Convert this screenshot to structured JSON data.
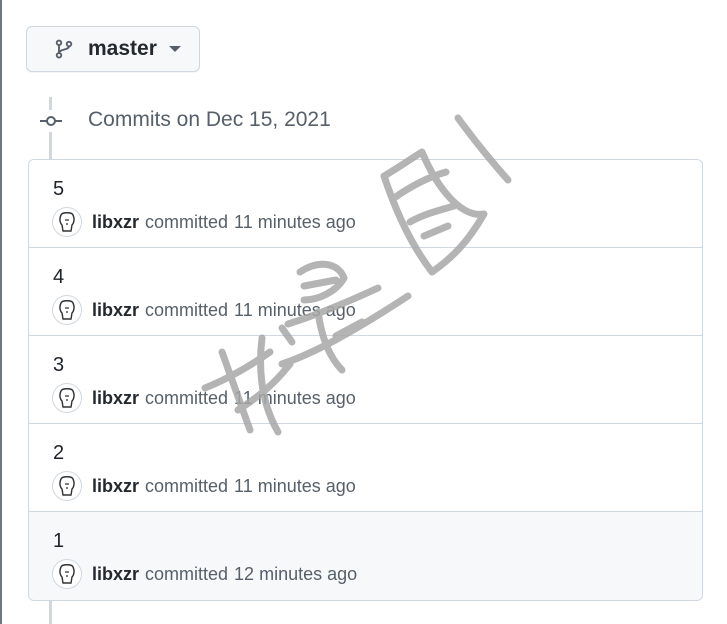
{
  "branch": {
    "name": "master"
  },
  "timeline": {
    "heading": "Commits on Dec 15, 2021"
  },
  "commits": [
    {
      "title": "5",
      "author": "libxzr",
      "action": "committed",
      "time": "11 minutes ago"
    },
    {
      "title": "4",
      "author": "libxzr",
      "action": "committed",
      "time": "11 minutes ago"
    },
    {
      "title": "3",
      "author": "libxzr",
      "action": "committed",
      "time": "11 minutes ago"
    },
    {
      "title": "2",
      "author": "libxzr",
      "action": "committed",
      "time": "11 minutes ago"
    },
    {
      "title": "1",
      "author": "libxzr",
      "action": "committed",
      "time": "12 minutes ago"
    }
  ],
  "watermark": {
    "text": "我是图!"
  },
  "icons": {
    "branch": "git-branch-icon",
    "commit": "git-commit-icon",
    "caret": "caret-down-icon",
    "avatar": "avatar-icon"
  },
  "colors": {
    "border": "#d0d7de",
    "muted_text": "#57606a",
    "hover_row": "#f6f8fa",
    "watermark": "#a8a8a8"
  }
}
